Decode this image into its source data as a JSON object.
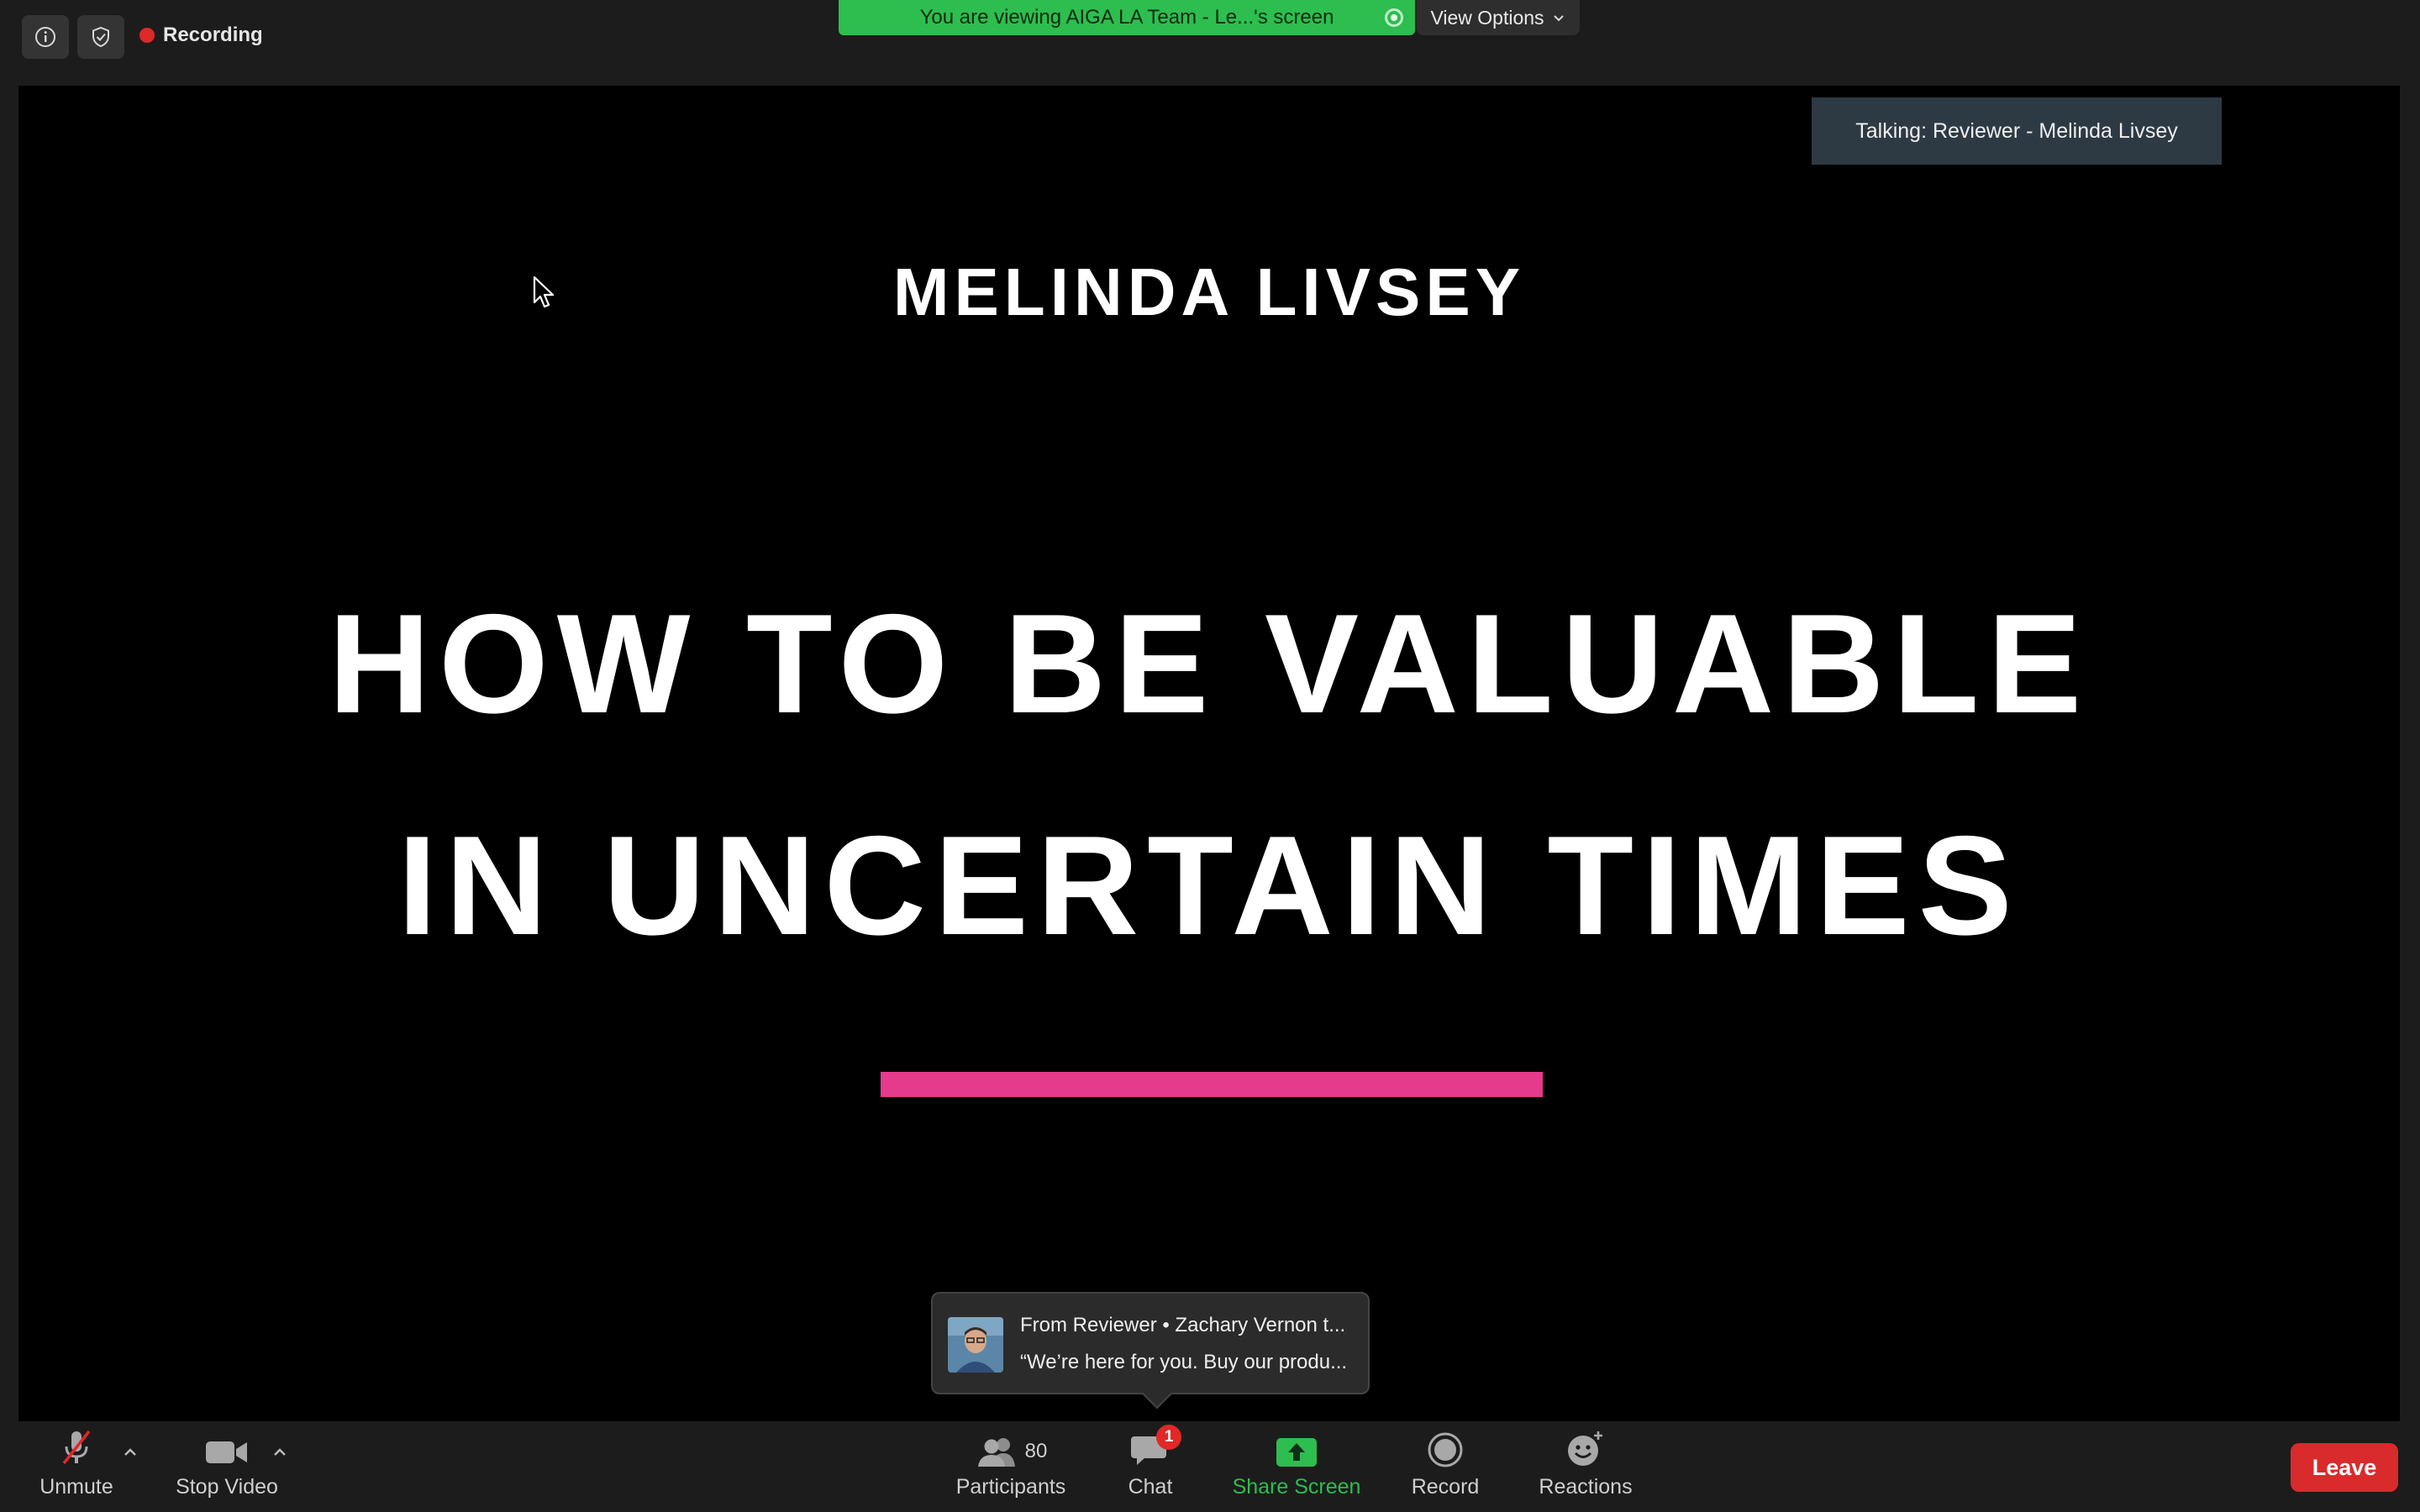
{
  "top_bar": {
    "info_icon": "info-icon",
    "security_icon": "shield-check-icon",
    "recording_label": "Recording",
    "viewing_banner": "You are viewing AIGA LA Team - Le...'s screen",
    "view_options_label": "View Options"
  },
  "shared_screen": {
    "talking_indicator": "Talking: Reviewer - Melinda Livsey",
    "slide": {
      "presenter_name": "MELINDA LIVSEY",
      "title_line_1": "HOW TO BE VALUABLE",
      "title_line_2": "IN UNCERTAIN TIMES",
      "accent_color": "#e63a8c"
    }
  },
  "chat_notification": {
    "from": "From Reviewer • Zachary Vernon t...",
    "message": "“We’re here for you. Buy our produ..."
  },
  "toolbar": {
    "unmute_label": "Unmute",
    "stop_video_label": "Stop Video",
    "participants_label": "Participants",
    "participants_count": "80",
    "chat_label": "Chat",
    "chat_badge": "1",
    "share_screen_label": "Share Screen",
    "record_label": "Record",
    "reactions_label": "Reactions",
    "leave_label": "Leave"
  },
  "colors": {
    "recording": "#e02828",
    "viewing_banner": "#2ebd4f",
    "share_screen": "#2ebd4f",
    "leave": "#d92b2b"
  }
}
